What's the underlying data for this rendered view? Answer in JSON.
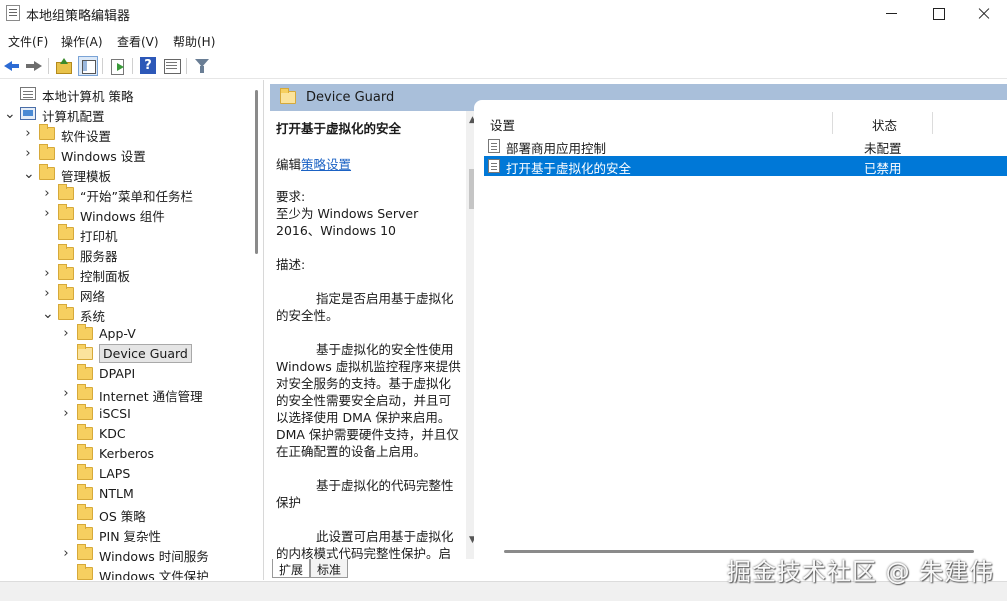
{
  "window": {
    "title": "本地组策略编辑器"
  },
  "menu": [
    "文件(F)",
    "操作(A)",
    "查看(V)",
    "帮助(H)"
  ],
  "tree": [
    {
      "label": "本地计算机 策略",
      "icon": "policy-doc",
      "level": 0,
      "expander": "none"
    },
    {
      "label": "计算机配置",
      "icon": "computer",
      "level": 0,
      "expander": "expanded"
    },
    {
      "label": "软件设置",
      "icon": "folder",
      "level": 1,
      "expander": "collapsed"
    },
    {
      "label": "Windows 设置",
      "icon": "folder",
      "level": 1,
      "expander": "collapsed"
    },
    {
      "label": "管理模板",
      "icon": "folder",
      "level": 1,
      "expander": "expanded"
    },
    {
      "label": "“开始”菜单和任务栏",
      "icon": "folder",
      "level": 2,
      "expander": "collapsed"
    },
    {
      "label": "Windows 组件",
      "icon": "folder",
      "level": 2,
      "expander": "collapsed"
    },
    {
      "label": "打印机",
      "icon": "folder",
      "level": 2,
      "expander": "none"
    },
    {
      "label": "服务器",
      "icon": "folder",
      "level": 2,
      "expander": "none"
    },
    {
      "label": "控制面板",
      "icon": "folder",
      "level": 2,
      "expander": "collapsed"
    },
    {
      "label": "网络",
      "icon": "folder",
      "level": 2,
      "expander": "collapsed"
    },
    {
      "label": "系统",
      "icon": "folder",
      "level": 2,
      "expander": "expanded"
    },
    {
      "label": "App-V",
      "icon": "folder",
      "level": 3,
      "expander": "collapsed"
    },
    {
      "label": "Device Guard",
      "icon": "folder-open",
      "level": 3,
      "expander": "none",
      "selected": true
    },
    {
      "label": "DPAPI",
      "icon": "folder",
      "level": 3,
      "expander": "none"
    },
    {
      "label": "Internet 通信管理",
      "icon": "folder",
      "level": 3,
      "expander": "collapsed"
    },
    {
      "label": "iSCSI",
      "icon": "folder",
      "level": 3,
      "expander": "collapsed"
    },
    {
      "label": "KDC",
      "icon": "folder",
      "level": 3,
      "expander": "none"
    },
    {
      "label": "Kerberos",
      "icon": "folder",
      "level": 3,
      "expander": "none"
    },
    {
      "label": "LAPS",
      "icon": "folder",
      "level": 3,
      "expander": "none"
    },
    {
      "label": "NTLM",
      "icon": "folder",
      "level": 3,
      "expander": "none"
    },
    {
      "label": "OS 策略",
      "icon": "folder",
      "level": 3,
      "expander": "none"
    },
    {
      "label": "PIN 复杂性",
      "icon": "folder",
      "level": 3,
      "expander": "none"
    },
    {
      "label": "Windows 时间服务",
      "icon": "folder",
      "level": 3,
      "expander": "collapsed"
    },
    {
      "label": "Windows 文件保护",
      "icon": "folder",
      "level": 3,
      "expander": "none"
    }
  ],
  "header": {
    "folder_title": "Device Guard"
  },
  "description": {
    "title": "打开基于虚拟化的安全",
    "edit_prefix": "编辑",
    "edit_link": "策略设置",
    "requirements_label": "要求:",
    "requirements_text": "至少为 Windows Server 2016、Windows 10",
    "description_label": "描述:",
    "paragraphs": [
      "指定是否启用基于虚拟化的安全性。",
      "基于虚拟化的安全性使用 Windows 虚拟机监控程序来提供对安全服务的支持。基于虚拟化的安全性需要安全启动，并且可以选择使用 DMA 保护来启用。DMA 保护需要硬件支持，并且仅在正确配置的设备上启用。",
      "基于虚拟化的代码完整性保护",
      "此设置可启用基于虚拟化的内核模式代码完整性保护。启用此"
    ]
  },
  "settings": {
    "columns": {
      "setting": "设置",
      "state": "状态"
    },
    "rows": [
      {
        "name": "部署商用应用控制",
        "state": "未配置",
        "selected": false
      },
      {
        "name": "打开基于虚拟化的安全",
        "state": "已禁用",
        "selected": true
      }
    ]
  },
  "tabs": [
    "扩展",
    "标准"
  ],
  "watermark": "掘金技术社区 @ 朱建伟",
  "colors": {
    "selection": "#0078d7",
    "header_band": "#a9bfda",
    "link": "#1b62c4"
  }
}
